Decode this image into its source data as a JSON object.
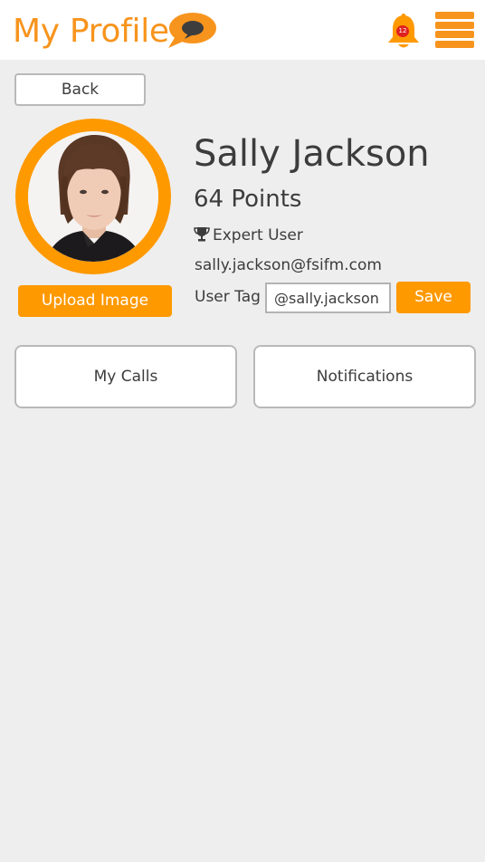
{
  "header": {
    "title": "My Profile",
    "logo_icon": "chat-bubble-icon",
    "notification_count": "12",
    "bell_icon": "bell-icon",
    "menu_icon": "hamburger-menu-icon"
  },
  "nav": {
    "back_label": "Back"
  },
  "profile": {
    "name": "Sally Jackson",
    "points": "64 Points",
    "level": "Expert User",
    "level_icon": "trophy-icon",
    "email": "sally.jackson@fsifm.com",
    "upload_label": "Upload Image",
    "user_tag_label": "User Tag",
    "user_tag_value": "@sally.jackson",
    "save_label": "Save"
  },
  "tiles": [
    {
      "label": "My Calls"
    },
    {
      "label": "Notifications"
    }
  ],
  "colors": {
    "accent": "#ff9900",
    "title_orange": "#f7941d",
    "header_bg": "#ffffff",
    "page_bg": "#eeeeee",
    "text": "#3c3c3c",
    "badge": "#e02020"
  }
}
